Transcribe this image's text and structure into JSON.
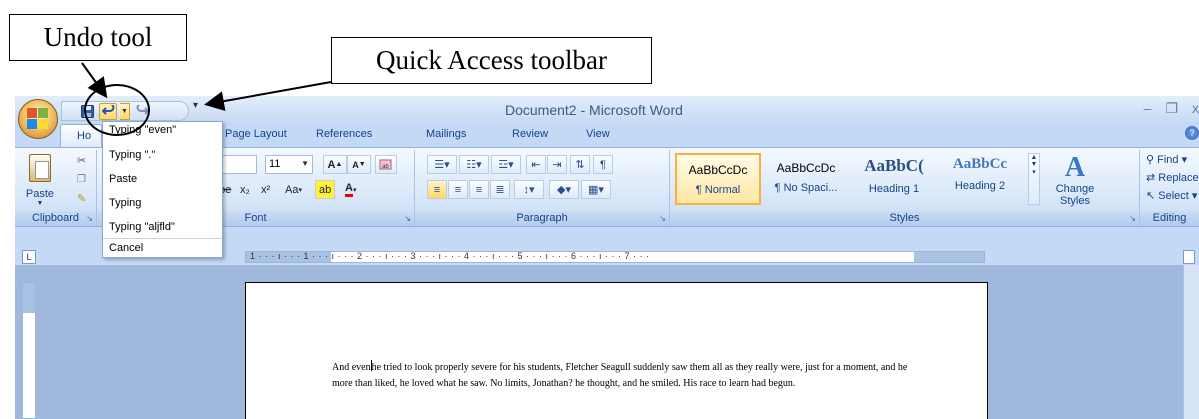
{
  "annotations": {
    "undo_label": "Undo tool",
    "qat_label": "Quick Access toolbar"
  },
  "window": {
    "title": "Document2 - Microsoft Word",
    "minimize": "–",
    "maximize": "❐",
    "close": "x",
    "help": "?"
  },
  "qat": {
    "save_icon": "save-icon",
    "undo_icon": "undo-icon",
    "redo_icon": "redo-icon",
    "customize": "▾"
  },
  "tabs": {
    "home": "Ho",
    "page_layout": "Page Layout",
    "references": "References",
    "mailings": "Mailings",
    "review": "Review",
    "view": "View"
  },
  "ribbon": {
    "clipboard": {
      "label": "Clipboard",
      "paste": "Paste"
    },
    "font": {
      "label": "Font",
      "name_fragment": "n",
      "size": "11",
      "grow": "A",
      "shrink": "A",
      "row2_fragment": "abe",
      "subscript": "x₂",
      "superscript": "x²",
      "change_case": "Aa",
      "highlight": "ab",
      "font_color": "A"
    },
    "paragraph": {
      "label": "Paragraph",
      "show_marks": "¶"
    },
    "styles": {
      "label": "Styles",
      "items": [
        {
          "sample": "AaBbCcDc",
          "name": "¶ Normal"
        },
        {
          "sample": "AaBbCcDc",
          "name": "¶ No Spaci..."
        },
        {
          "sample": "AaBbC(",
          "name": "Heading 1"
        },
        {
          "sample": "AaBbCc",
          "name": "Heading 2"
        }
      ],
      "change_styles": "Change Styles"
    },
    "editing": {
      "label": "Editing",
      "find": "Find",
      "replace": "Replace",
      "select": "Select"
    }
  },
  "undo_menu": {
    "items": [
      "Typing \"even\"",
      "Typing \".\"",
      "Paste",
      "Typing",
      "Typing \"aljfld\""
    ],
    "cancel": "Cancel"
  },
  "ruler": {
    "ticks": "1 · · · ı · · · 1 · · · ı · · · 2 · · · ı · · · 3 · · · ı · · · 4 · · · ı · · · 5 · · · ı · · · 6 · · · ı · · · 7 · · ·"
  },
  "document": {
    "text_before_cursor": "And even",
    "text_after_cursor": "he tried to look properly severe for his students, Fletcher Seagull  suddenly saw them all  as they really were, just for a moment, and he more than liked, he loved what he saw. No limits, Jonathan? he thought, and he smiled. His race to learn had begun."
  }
}
